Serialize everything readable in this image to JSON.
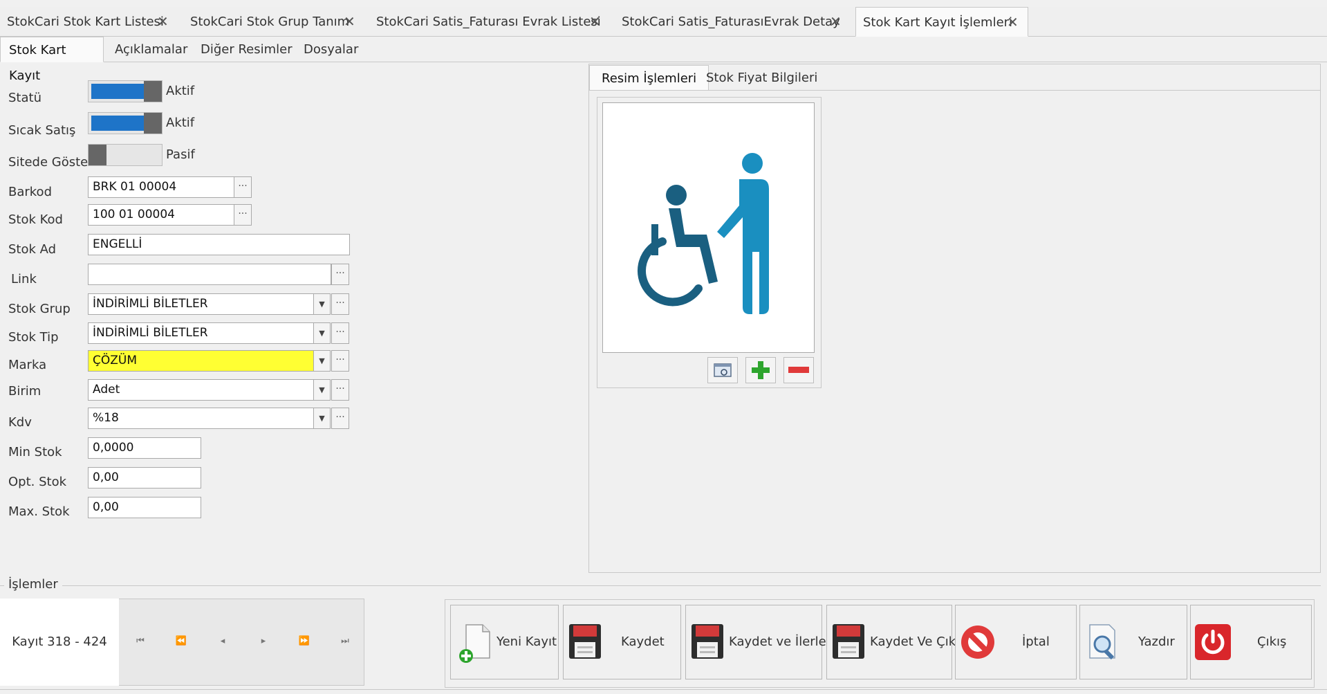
{
  "doc_tabs": [
    {
      "label": "StokCari Stok Kart Listesi"
    },
    {
      "label": "StokCari Stok Grup Tanım"
    },
    {
      "label": "StokCari Satis_Faturası Evrak Listesi"
    },
    {
      "label": "StokCari Satis_FaturasıEvrak Detay"
    },
    {
      "label": "Stok Kart Kayıt İşlemleri",
      "active": true
    }
  ],
  "close_glyph": "✕",
  "sub_tabs": [
    {
      "label": "Stok Kart Kayıt",
      "active": true
    },
    {
      "label": "Açıklamalar"
    },
    {
      "label": "Diğer Resimler"
    },
    {
      "label": "Dosyalar"
    }
  ],
  "form": {
    "statu": {
      "label": "Statü",
      "state": "Aktif",
      "on": true
    },
    "sicak_satis": {
      "label": "Sıcak Satış",
      "state": "Aktif",
      "on": true
    },
    "sitede_goster": {
      "label": "Sitede Göster",
      "state": "Pasif",
      "on": false
    },
    "barkod": {
      "label": "Barkod",
      "value": "BRK 01 00004"
    },
    "stok_kod": {
      "label": "Stok Kod",
      "value": "100 01 00004"
    },
    "stok_ad": {
      "label": "Stok Ad",
      "value": "ENGELLİ"
    },
    "link": {
      "label": "Link",
      "value": ""
    },
    "stok_grup": {
      "label": "Stok Grup",
      "value": "İNDİRİMLİ BİLETLER"
    },
    "stok_tip": {
      "label": "Stok Tip",
      "value": "İNDİRİMLİ BİLETLER"
    },
    "marka": {
      "label": "Marka",
      "value": "ÇÖZÜM",
      "highlight": "#ffff33"
    },
    "birim": {
      "label": "Birim",
      "value": "Adet"
    },
    "kdv": {
      "label": "Kdv",
      "value": "%18"
    },
    "min_stok": {
      "label": "Min Stok",
      "value": "0,0000"
    },
    "opt_stok": {
      "label": "Opt. Stok",
      "value": "0,00"
    },
    "max_stok": {
      "label": "Max. Stok",
      "value": "0,00"
    }
  },
  "ellipsis_glyph": "···",
  "dropdown_glyph": "▼",
  "right_tabs": [
    {
      "label": "Resim İşlemleri",
      "active": true
    },
    {
      "label": "Stok Fiyat Bilgileri"
    }
  ],
  "image": {
    "icon": "wheelchair-assist-icon",
    "color": "#1a8fc0",
    "dark": "#1a5f80"
  },
  "image_buttons": [
    "view-image-icon",
    "add-image-icon",
    "remove-image-icon"
  ],
  "islemler": {
    "title": "İşlemler"
  },
  "navigator": {
    "count_text": "Kayıt 318 - 424",
    "buttons": [
      "⏮",
      "⏪",
      "◂",
      "▸",
      "⏩",
      "⏭"
    ]
  },
  "actions": [
    {
      "label": "Yeni Kayıt",
      "icon": "new-document-icon"
    },
    {
      "label": "Kaydet",
      "icon": "floppy-disk-icon"
    },
    {
      "label": "Kaydet ve İlerle",
      "icon": "floppy-disk-icon"
    },
    {
      "label": "Kaydet Ve Çık",
      "icon": "floppy-disk-icon"
    },
    {
      "label": "İptal",
      "icon": "cancel-icon"
    },
    {
      "label": "Yazdır",
      "icon": "print-preview-icon"
    },
    {
      "label": "Çıkış",
      "icon": "power-icon"
    }
  ],
  "colors": {
    "toggle_on": "#1e74c8",
    "exit_red": "#d9262b",
    "cancel_red": "#e03a3a",
    "add_green": "#2ea52e"
  }
}
